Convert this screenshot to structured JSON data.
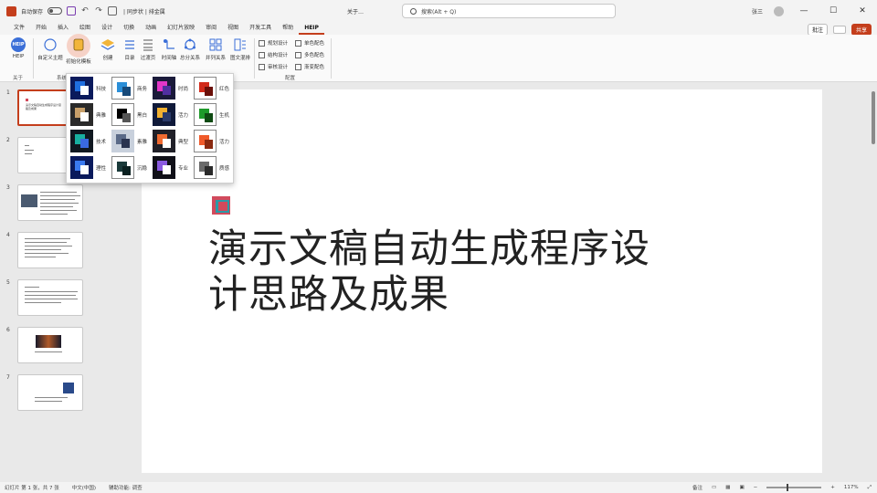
{
  "titlebar": {
    "autosave": "自动保存",
    "toggle": "关",
    "qat_extra": "| 同步状 | 排金属",
    "doc_title": "关于…",
    "search_placeholder": "搜索(Alt + Q)",
    "user": "张三",
    "buttons": [
      "—",
      "☐",
      "✕"
    ]
  },
  "tabs": [
    "文件",
    "开始",
    "插入",
    "绘图",
    "设计",
    "切换",
    "动画",
    "幻灯片放映",
    "审阅",
    "视图",
    "开发工具",
    "帮助",
    "HEIP"
  ],
  "active_tab": "HEIP",
  "tab_actions": {
    "comments": "批注",
    "share": "共享"
  },
  "ribbon": {
    "buttons": [
      {
        "label": "HEIP",
        "icon": "help-logo-icon"
      },
      {
        "label": "自定义主题",
        "icon": "theme-icon"
      },
      {
        "label": "初始化模板",
        "icon": "template-icon"
      },
      {
        "label": "创建",
        "icon": "layers-icon"
      },
      {
        "label": "目录",
        "icon": "list-icon"
      },
      {
        "label": "过渡页",
        "icon": "transition-icon"
      },
      {
        "label": "时间轴",
        "icon": "timeline-icon"
      },
      {
        "label": "总分关系",
        "icon": "hierarchy-icon"
      },
      {
        "label": "并列关系",
        "icon": "grid-icon"
      },
      {
        "label": "图文混排",
        "icon": "layout-icon"
      }
    ],
    "small_buttons": [
      "规划设计",
      "结构设计",
      "审核设计",
      "单色配色",
      "多色配色",
      "渐变配色"
    ],
    "groups": [
      "关于",
      "系统",
      "配置"
    ]
  },
  "slides": {
    "numbers": [
      "1",
      "2",
      "3",
      "4",
      "5",
      "6",
      "7"
    ],
    "first_thumb_text": "演示文稿自动生成程序设计思路及成果"
  },
  "slide": {
    "title_line1": "演示文稿自动生成程序设",
    "title_line2": "计思路及成果"
  },
  "status": {
    "slide_pos": "幻灯片 第 1 张，共 7 张",
    "lang": "中文(中国)",
    "accessibility": "辅助功能: 调查",
    "notes": "备注",
    "zoom": "117%"
  },
  "gallery": {
    "items": [
      {
        "label": "科技",
        "bg": "#0a1a5c",
        "a": "#1f6fe0",
        "b": "#ffffff"
      },
      {
        "label": "商务",
        "bg": "#ffffff",
        "a": "#2b8fd8",
        "b": "#174a7a"
      },
      {
        "label": "时尚",
        "bg": "#1a1a3a",
        "a": "#e236c8",
        "b": "#5030a0"
      },
      {
        "label": "红色",
        "bg": "#ffffff",
        "a": "#d22a1a",
        "b": "#6a0f08"
      },
      {
        "label": "典雅",
        "bg": "#2a2a2a",
        "a": "#c8a06a",
        "b": "#ffffff"
      },
      {
        "label": "黑白",
        "bg": "#ffffff",
        "a": "#000000",
        "b": "#555555"
      },
      {
        "label": "活力",
        "bg": "#101a3a",
        "a": "#f0b030",
        "b": "#2a3a6a"
      },
      {
        "label": "生机",
        "bg": "#ffffff",
        "a": "#1e9a2a",
        "b": "#0e4a12"
      },
      {
        "label": "技术",
        "bg": "#101820",
        "a": "#18b0a0",
        "b": "#3a6ae0"
      },
      {
        "label": "素雅",
        "bg": "#c8d0dc",
        "a": "#5a6a88",
        "b": "#2a3450"
      },
      {
        "label": "典型",
        "bg": "#202028",
        "a": "#f06a30",
        "b": "#ffffff"
      },
      {
        "label": "活力",
        "bg": "#ffffff",
        "a": "#f05a2a",
        "b": "#8a2a10"
      },
      {
        "label": "理性",
        "bg": "#0a1a5c",
        "a": "#3a7af0",
        "b": "#ffffff"
      },
      {
        "label": "沉稳",
        "bg": "#ffffff",
        "a": "#1a3a3a",
        "b": "#0a2020"
      },
      {
        "label": "专业",
        "bg": "#101018",
        "a": "#8a5ae0",
        "b": "#ffffff"
      },
      {
        "label": "质感",
        "bg": "#ffffff",
        "a": "#6a6a6a",
        "b": "#2a2a2a"
      }
    ]
  },
  "colors": {
    "accent": "#c43e1c",
    "logo_pink": "#d24a5c",
    "logo_teal": "#2b9aa7"
  }
}
